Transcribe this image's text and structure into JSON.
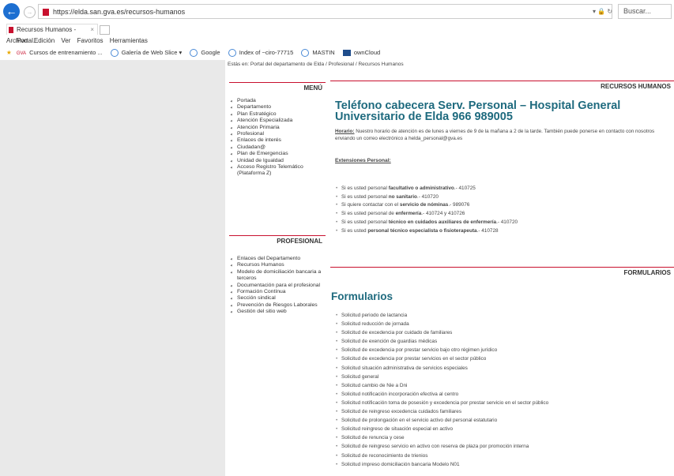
{
  "browser": {
    "url": "https://elda.san.gva.es/recursos-humanos",
    "search_placeholder": "Buscar...",
    "tab_title": "Recursos Humanos - Portal...",
    "menu": [
      "Archivo",
      "Edición",
      "Ver",
      "Favoritos",
      "Herramientas"
    ],
    "favorites": [
      "Cursos de entrenamiento ...",
      "Galería de Web Slice ▾",
      "Google",
      "Index of ~ciro-77715",
      "MASTIN",
      "ownCloud"
    ]
  },
  "breadcrumb": "Estás en:  Portal del departamento de Elda  /  Profesional  /  Recursos Humanos",
  "menu_box": {
    "title": "MENÚ",
    "items": [
      "Portada",
      "Departamento",
      "Plan Estratégico",
      "Atención Especializada",
      "Atención Primaria",
      "Profesional",
      "Enlaces de interés",
      "Ciudadan@",
      "Plan de Emergencias",
      "Unidad de Igualdad",
      "Acceso Registro Telemático (Plataforma Z)"
    ]
  },
  "profesional_box": {
    "title": "PROFESIONAL",
    "items": [
      "Enlaces del Departamento",
      "Recursos Humanos",
      "Modelo de domiciliación bancaria a terceros",
      "Documentación para el profesional",
      "Formación Contínua",
      "Sección sindical",
      "Prevención de Riesgos Laborales",
      "Gestión del sitio web"
    ]
  },
  "rrhh": {
    "header": "RECURSOS HUMANOS",
    "title": "Teléfono cabecera Serv. Personal – Hospital General Universitario de Elda 966 989005",
    "horario_label": "Horario:",
    "horario_text": " Nuestro horario de atención es de lunes a viernes de 9 de la mañana a 2 de la tarde. También puede ponerse en contacto con nosotros enviando un correo electrónico a helda_personal@gva.es",
    "ext_title": "Extensiones Personal:",
    "extensions": [
      [
        "Si es usted personal ",
        "facultativo o administrativo",
        ".- 410725"
      ],
      [
        "Si es usted personal ",
        "no sanitario",
        ".- 410720"
      ],
      [
        "Si quiere contactar con el ",
        "servicio de nóminas",
        ".- 989076"
      ],
      [
        "Si es usted personal de ",
        "enfermería",
        ".- 410724 y 410726"
      ],
      [
        "Si es usted personal ",
        "técnico en cuidados auxiliares de enfermería",
        ".- 410720"
      ],
      [
        "Si es usted ",
        "personal técnico especialista o fisioterapeuta",
        ".- 410728"
      ]
    ]
  },
  "formularios": {
    "header": "FORMULARIOS",
    "title": "Formularios",
    "items": [
      "Solicitud periodo de lactancia",
      "Solicitud reducción de jornada",
      "Solicitud de excedencia por cuidado de familiares",
      "Solicitud de exención de guardias médicas",
      "Solicitud de excedencia por prestar servicio bajo otro régimen jurídico",
      "Solicitud de excedencia por prestar servicios en el sector público",
      "Solicitud situación administrativa de servicios especiales",
      "Solicitud general",
      "Solicitud cambio de Nie a Dni",
      "Solicitud notificación incorporación efectiva al centro",
      "Solicitud notificación toma de posesión y excedencia por prestar servicio en el sector público",
      "Solicitud de reingreso excedencia cuidados familiares",
      "Solicitud de prolongación en el servicio activo del personal estatutario",
      "Solicitud reingreso de situación especial en activo",
      "Solicitud de renuncia y cese",
      "Solicitud de reingreso servicio en activo con reserva de plaza por promoción interna",
      "Solicitud de reconocimiento de trienios",
      "Solicitud impreso domiciliación bancaria Modelo N01"
    ]
  }
}
